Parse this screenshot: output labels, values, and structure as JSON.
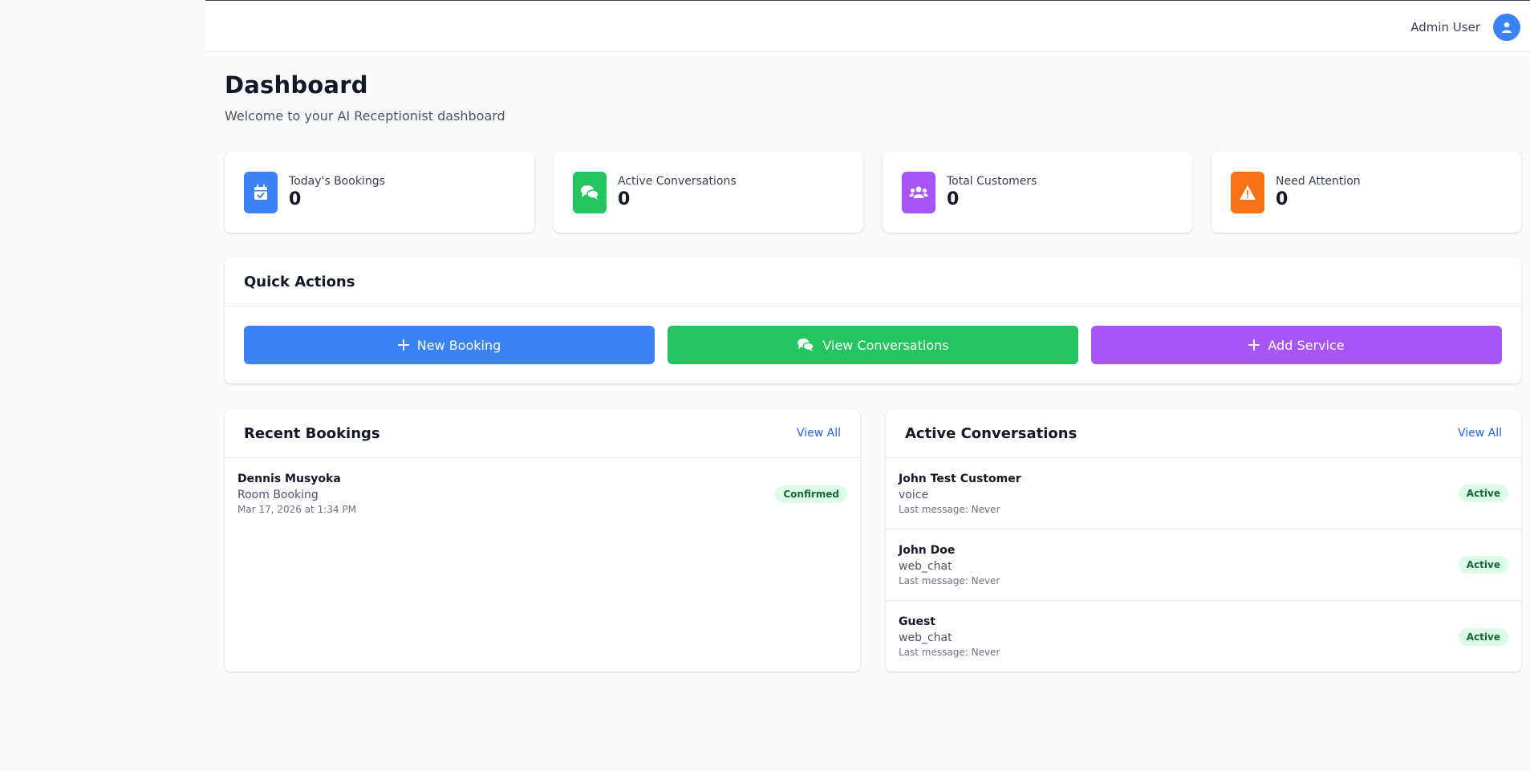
{
  "header": {
    "user_name": "Admin User"
  },
  "page": {
    "title": "Dashboard",
    "subtitle": "Welcome to your AI Receptionist dashboard"
  },
  "stats": [
    {
      "label": "Today's Bookings",
      "value": "0",
      "icon": "calendar-check-icon",
      "color": "#3b82f6"
    },
    {
      "label": "Active Conversations",
      "value": "0",
      "icon": "comments-icon",
      "color": "#22c55e"
    },
    {
      "label": "Total Customers",
      "value": "0",
      "icon": "users-icon",
      "color": "#a855f7"
    },
    {
      "label": "Need Attention",
      "value": "0",
      "icon": "warning-icon",
      "color": "#f97316"
    }
  ],
  "quick_actions": {
    "title": "Quick Actions",
    "buttons": [
      {
        "label": "New Booking",
        "icon": "plus-icon",
        "color": "#3b82f6"
      },
      {
        "label": "View Conversations",
        "icon": "comments-icon",
        "color": "#22c55e"
      },
      {
        "label": "Add Service",
        "icon": "plus-icon",
        "color": "#a855f7"
      }
    ]
  },
  "recent_bookings": {
    "title": "Recent Bookings",
    "view_all": "View All",
    "items": [
      {
        "name": "Dennis Musyoka",
        "service": "Room Booking",
        "datetime": "Mar 17, 2026 at 1:34 PM",
        "status": "Confirmed"
      }
    ]
  },
  "active_conversations": {
    "title": "Active Conversations",
    "view_all": "View All",
    "items": [
      {
        "name": "John Test Customer",
        "channel": "voice",
        "last_message": "Last message: Never",
        "status": "Active"
      },
      {
        "name": "John Doe",
        "channel": "web_chat",
        "last_message": "Last message: Never",
        "status": "Active"
      },
      {
        "name": "Guest",
        "channel": "web_chat",
        "last_message": "Last message: Never",
        "status": "Active"
      }
    ]
  }
}
